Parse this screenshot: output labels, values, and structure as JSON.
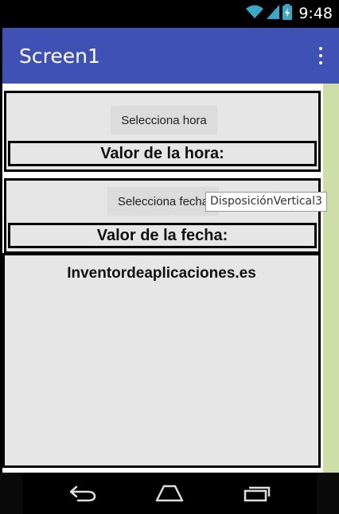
{
  "status_bar": {
    "time": "9:48",
    "icons": [
      "wifi-icon",
      "signal-icon",
      "battery-icon"
    ]
  },
  "app_bar": {
    "title": "Screen1",
    "overflow_icon": "overflow-menu-icon"
  },
  "layout_time": {
    "button_label": "Selecciona hora",
    "value_label": "Valor de la hora:"
  },
  "layout_date": {
    "button_label": "Selecciona fecha",
    "value_label": "Valor de la fecha:"
  },
  "layout_vertical3": {
    "label": "Inventordeaplicaciones.es"
  },
  "tooltip": {
    "text": "DisposiciónVertical3"
  },
  "nav_bar": {
    "icons": [
      "back-icon",
      "home-icon",
      "recents-icon"
    ]
  },
  "colors": {
    "app_bar": "#3f51b5",
    "screen_bg": "#ffffff",
    "container_bg": "#e6e6e6",
    "side_strip": "#cddea6"
  }
}
